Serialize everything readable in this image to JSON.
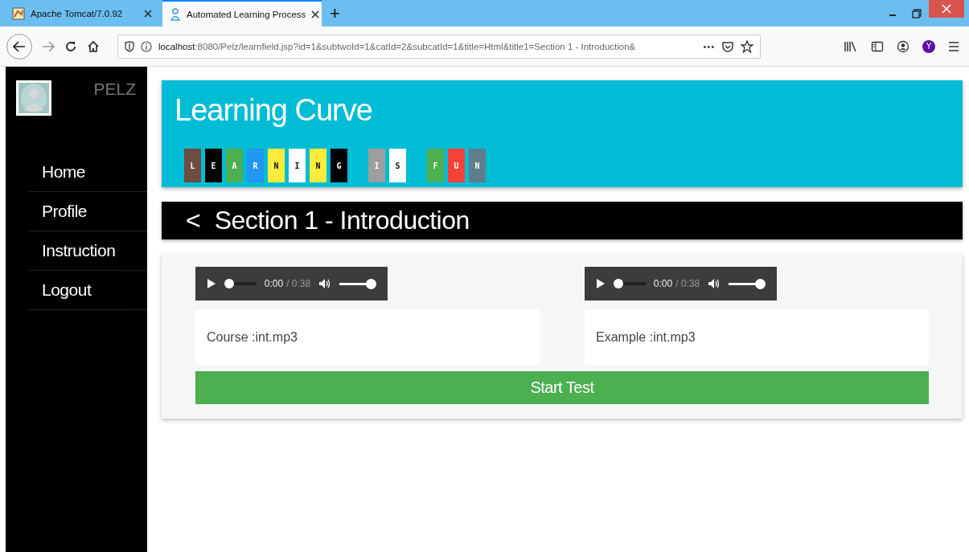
{
  "browser": {
    "tabs": [
      {
        "label": "Apache Tomcat/7.0.92",
        "selected": false
      },
      {
        "label": "Automated Learning Process",
        "selected": true
      }
    ],
    "new_tab": "+",
    "url_host": "localhost",
    "url_rest": ":8080/Pelz/learnfield.jsp?id=1&subtwoId=1&catId=2&subcatId=1&title=Html&title1=Section 1 - Introduction&",
    "more": "•••",
    "profile_badge": "Y"
  },
  "sidebar": {
    "brand": "PELZ",
    "items": [
      {
        "label": "Home"
      },
      {
        "label": "Profile"
      },
      {
        "label": "Instruction"
      },
      {
        "label": "Logout"
      }
    ]
  },
  "header": {
    "title": "Learning Curve",
    "words": [
      {
        "letters": [
          {
            "text": "L",
            "color": "#6d4c41"
          },
          {
            "text": "E",
            "color": "#000000"
          },
          {
            "text": "A",
            "color": "#4caf50"
          },
          {
            "text": "R",
            "color": "#2196f3"
          },
          {
            "text": "N",
            "color": "#ffeb3b"
          },
          {
            "text": "I",
            "color": "#ffffff"
          },
          {
            "text": "N",
            "color": "#ffeb3b"
          },
          {
            "text": "G",
            "color": "#000000"
          }
        ]
      },
      {
        "letters": [
          {
            "text": "I",
            "color": "#9e9e9e"
          },
          {
            "text": "S",
            "color": "#ffffff"
          }
        ]
      },
      {
        "letters": [
          {
            "text": "F",
            "color": "#4caf50"
          },
          {
            "text": "U",
            "color": "#f44336"
          },
          {
            "text": "N",
            "color": "#607d8b"
          }
        ]
      }
    ]
  },
  "section": {
    "back": "<",
    "title": "Section 1 - Introduction"
  },
  "media": [
    {
      "time": "0:00",
      "duration": "/ 0:38",
      "level": 0,
      "volume": {
        "level": 1
      },
      "label": "Course :int.mp3"
    },
    {
      "time": "0:00",
      "duration": "/ 0:38",
      "level": 0,
      "volume": {
        "level": 1
      },
      "label": "Example :int.mp3"
    }
  ],
  "start_button": "Start Test"
}
